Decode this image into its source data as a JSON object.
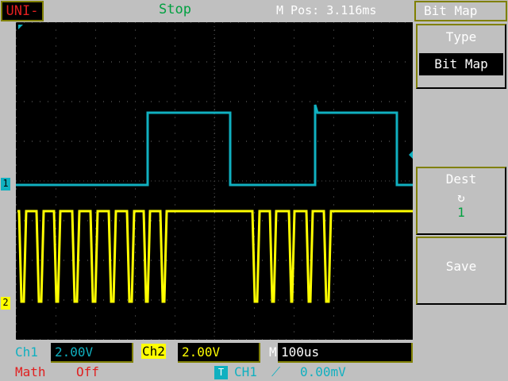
{
  "header": {
    "logo": "UNI-T",
    "status": "Stop",
    "mpos": "M Pos: 3.116ms"
  },
  "menu": {
    "title": "Bit Map",
    "type_label": "Type",
    "type_value": "Bit Map",
    "dest_label": "Dest",
    "dest_icon": "↻",
    "dest_value": "1",
    "save_label": "Save"
  },
  "channels": {
    "ch1_marker": "1",
    "ch2_marker": "2"
  },
  "footer": {
    "ch1_label": "Ch1",
    "ch1_scale": "2.00V",
    "ch2_label": "Ch2",
    "ch2_scale": "2.00V",
    "time_label": "M",
    "time_scale": "100us",
    "math_label": "Math",
    "math_value": "Off",
    "trig_icon": "T",
    "trig_source": "CH1",
    "trig_slope": "⟋",
    "trig_level": "0.00mV"
  },
  "colors": {
    "ch1": "#10b0c0",
    "ch2": "#ffff00",
    "math": "#e02020"
  }
}
